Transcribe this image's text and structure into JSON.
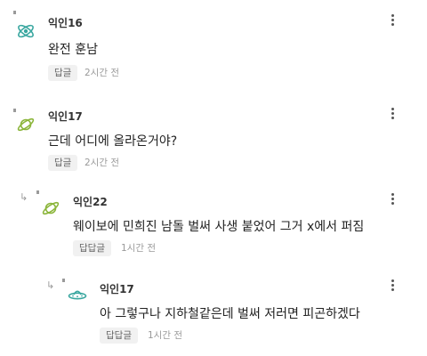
{
  "comments": [
    {
      "author": "익인16",
      "text": "완전 훈남",
      "reply_label": "답글",
      "time": "2시간 전",
      "avatar_color": "#3aa7a0",
      "avatar_icon": "atom-icon"
    },
    {
      "author": "익인17",
      "text": "근데 어디에 올라온거야?",
      "reply_label": "답글",
      "time": "2시간 전",
      "avatar_color": "#8bb53a",
      "avatar_icon": "planet-icon"
    },
    {
      "author": "익인22",
      "text": "웨이보에 민희진 남돌 벌써 사생 붙었어 그거 x에서 퍼짐",
      "reply_label": "답답글",
      "time": "1시간 전",
      "avatar_color": "#8bb53a",
      "avatar_icon": "planet-icon"
    },
    {
      "author": "익인17",
      "text": "아 그렇구나 지하철같은데 벌써 저러면 피곤하겠다",
      "reply_label": "답답글",
      "time": "1시간 전",
      "avatar_color": "#3aa7a0",
      "avatar_icon": "ufo-icon"
    }
  ]
}
